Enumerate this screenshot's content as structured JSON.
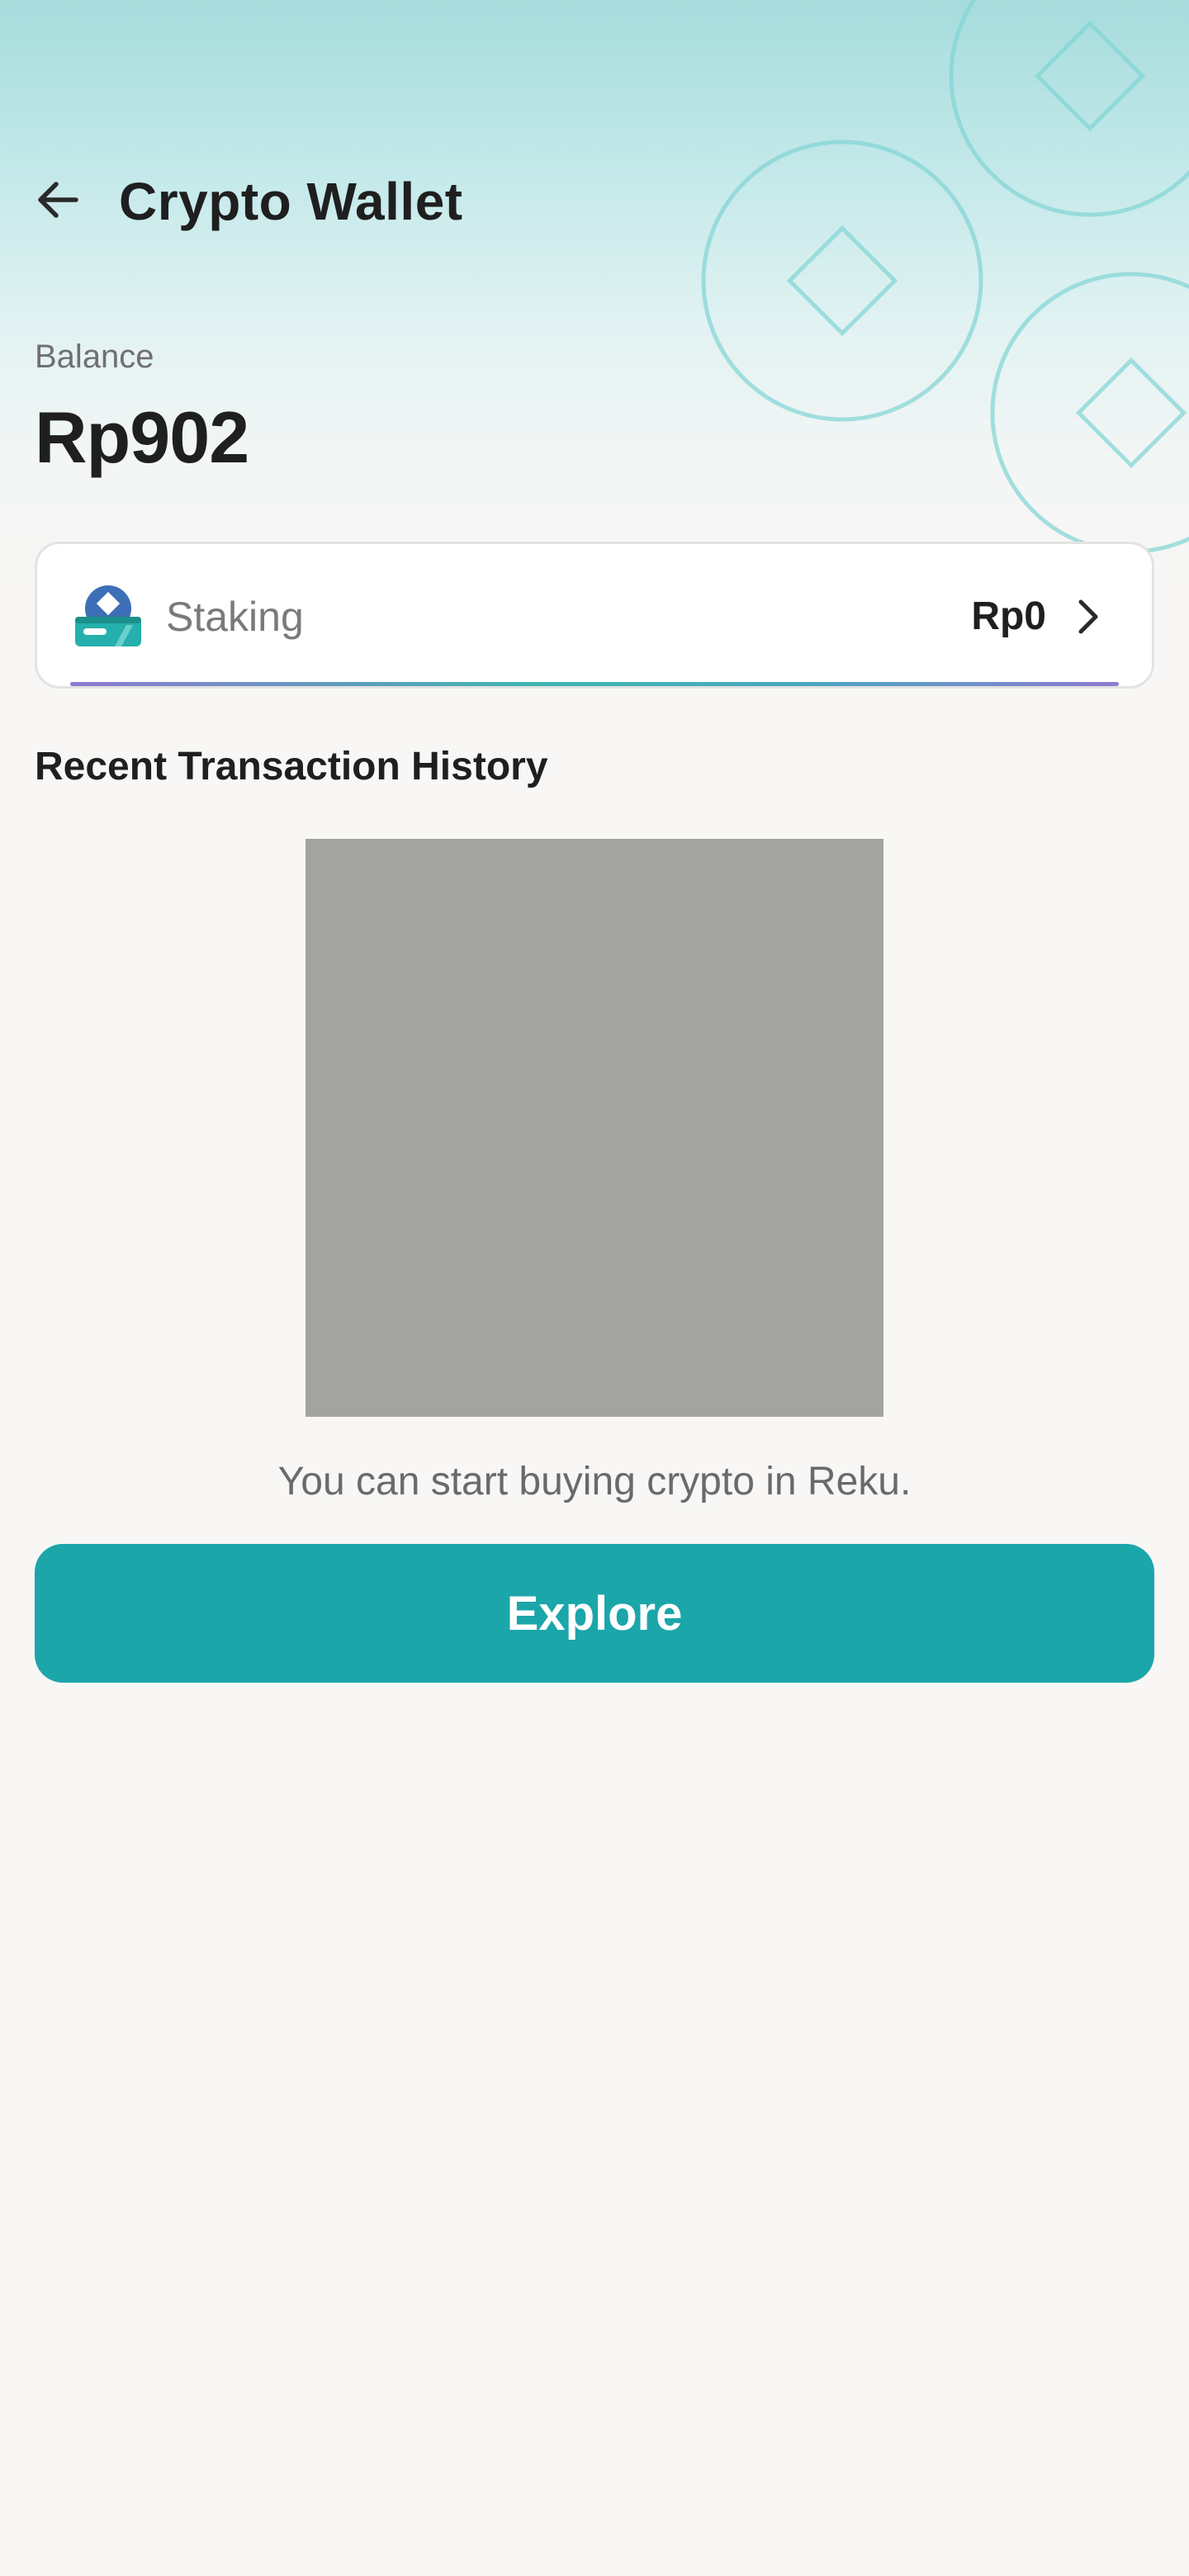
{
  "header": {
    "title": "Crypto Wallet",
    "back_icon": "arrow-left-icon"
  },
  "balance": {
    "label": "Balance",
    "value": "Rp902"
  },
  "staking": {
    "icon": "staking-icon",
    "label": "Staking",
    "value": "Rp0",
    "chevron_icon": "chevron-right-icon"
  },
  "history": {
    "title": "Recent Transaction History",
    "illustration": "empty-state-illustration",
    "empty_message": "You can start buying crypto in Reku."
  },
  "actions": {
    "explore_label": "Explore"
  },
  "colors": {
    "accent": "#1ba6aa",
    "hero_top": "#a6dcdc",
    "background": "#f8f7f5",
    "coin_outline": "#7fd3d3"
  }
}
